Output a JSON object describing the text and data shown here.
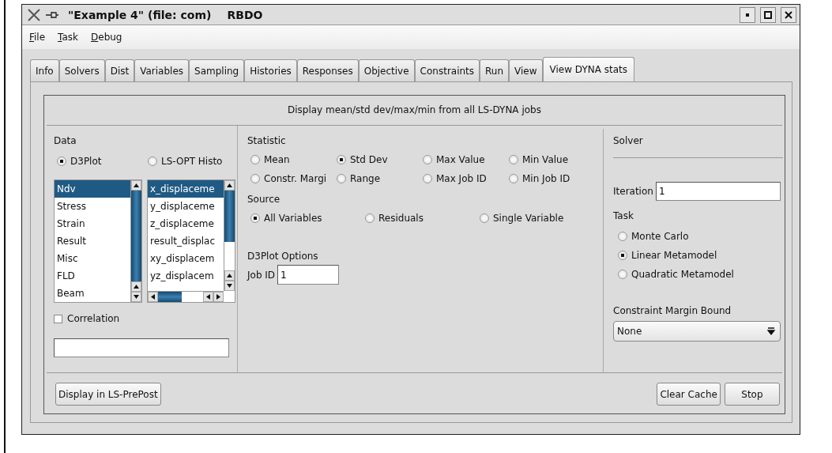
{
  "window": {
    "title": "\"Example 4\" (file: com)",
    "app": "RBDO"
  },
  "menu": [
    {
      "label": "File"
    },
    {
      "label": "Task"
    },
    {
      "label": "Debug"
    }
  ],
  "tabs": [
    {
      "label": "Info",
      "selected": false
    },
    {
      "label": "Solvers",
      "selected": false
    },
    {
      "label": "Dist",
      "selected": false
    },
    {
      "label": "Variables",
      "selected": false
    },
    {
      "label": "Sampling",
      "selected": false
    },
    {
      "label": "Histories",
      "selected": false
    },
    {
      "label": "Responses",
      "selected": false
    },
    {
      "label": "Objective",
      "selected": false
    },
    {
      "label": "Constraints",
      "selected": false
    },
    {
      "label": "Run",
      "selected": false
    },
    {
      "label": "View",
      "selected": false
    },
    {
      "label": "View DYNA stats",
      "selected": true
    }
  ],
  "heading": "Display mean/std dev/max/min from all LS-DYNA jobs",
  "data": {
    "title": "Data",
    "sources": [
      {
        "label": "D3Plot",
        "selected": true
      },
      {
        "label": "LS-OPT Histo",
        "selected": false
      }
    ],
    "categories": [
      {
        "label": "Ndv",
        "selected": true
      },
      {
        "label": "Stress",
        "selected": false
      },
      {
        "label": "Strain",
        "selected": false
      },
      {
        "label": "Result",
        "selected": false
      },
      {
        "label": "Misc",
        "selected": false
      },
      {
        "label": "FLD",
        "selected": false
      },
      {
        "label": "Beam",
        "selected": false
      }
    ],
    "components": [
      {
        "label": "x_displaceme",
        "selected": true
      },
      {
        "label": "y_displaceme",
        "selected": false
      },
      {
        "label": "z_displaceme",
        "selected": false
      },
      {
        "label": "result_displac",
        "selected": false
      },
      {
        "label": "xy_displacem",
        "selected": false
      },
      {
        "label": "yz_displacem",
        "selected": false
      }
    ],
    "correlation": {
      "label": "Correlation",
      "checked": false
    }
  },
  "statistic": {
    "title": "Statistic",
    "options": [
      {
        "label": "Mean",
        "selected": false
      },
      {
        "label": "Std Dev",
        "selected": true
      },
      {
        "label": "Max Value",
        "selected": false
      },
      {
        "label": "Min Value",
        "selected": false
      },
      {
        "label": "Constr. Margi",
        "selected": false
      },
      {
        "label": "Range",
        "selected": false
      },
      {
        "label": "Max Job ID",
        "selected": false
      },
      {
        "label": "Min Job ID",
        "selected": false
      }
    ]
  },
  "source": {
    "title": "Source",
    "options": [
      {
        "label": "All Variables",
        "selected": true
      },
      {
        "label": "Residuals",
        "selected": false
      },
      {
        "label": "Single Variable",
        "selected": false
      }
    ]
  },
  "d3plot_options": {
    "title": "D3Plot Options",
    "job_id_label": "Job ID",
    "job_id": "1"
  },
  "solver": {
    "title": "Solver",
    "iteration_label": "Iteration",
    "iteration": "1"
  },
  "task": {
    "title": "Task",
    "options": [
      {
        "label": "Monte Carlo",
        "selected": false
      },
      {
        "label": "Linear Metamodel",
        "selected": true
      },
      {
        "label": "Quadratic Metamodel",
        "selected": false
      }
    ]
  },
  "margin_bound": {
    "label": "Constraint Margin Bound",
    "value": "None"
  },
  "buttons": {
    "left": [
      "Display in LS-PrePost"
    ],
    "right": [
      "Clear Cache",
      "Stop"
    ]
  }
}
